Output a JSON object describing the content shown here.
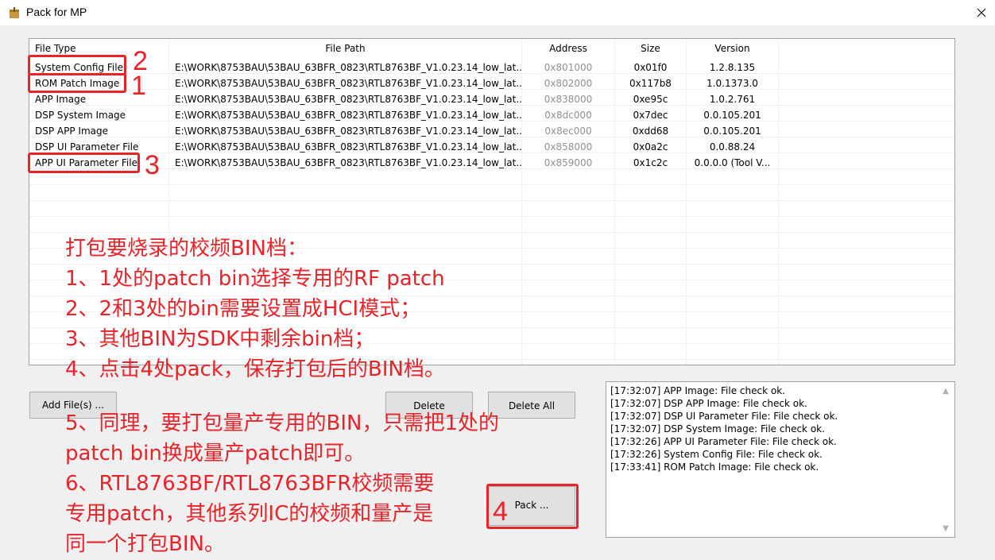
{
  "window": {
    "title": "Pack for MP"
  },
  "table": {
    "headers": [
      "File Type",
      "File Path",
      "Address",
      "Size",
      "Version"
    ],
    "rows": [
      [
        "System Config File",
        "E:\\WORK\\8753BAU\\53BAU_63BFR_0823\\RTL8763BF_V1.0.23.14_low_lat...",
        "0x801000",
        "0x01f0",
        "1.2.8.135"
      ],
      [
        "ROM Patch Image",
        "E:\\WORK\\8753BAU\\53BAU_63BFR_0823\\RTL8763BF_V1.0.23.14_low_lat...",
        "0x802000",
        "0x117b8",
        "1.0.1373.0"
      ],
      [
        "APP Image",
        "E:\\WORK\\8753BAU\\53BAU_63BFR_0823\\RTL8763BF_V1.0.23.14_low_lat...",
        "0x838000",
        "0xe95c",
        "1.0.2.761"
      ],
      [
        "DSP System Image",
        "E:\\WORK\\8753BAU\\53BAU_63BFR_0823\\RTL8763BF_V1.0.23.14_low_lat...",
        "0x8dc000",
        "0x7dec",
        "0.0.105.201"
      ],
      [
        "DSP APP Image",
        "E:\\WORK\\8753BAU\\53BAU_63BFR_0823\\RTL8763BF_V1.0.23.14_low_lat...",
        "0x8ec000",
        "0xdd68",
        "0.0.105.201"
      ],
      [
        "DSP UI Parameter File",
        "E:\\WORK\\8753BAU\\53BAU_63BFR_0823\\RTL8763BF_V1.0.23.14_low_lat...",
        "0x858000",
        "0x0a2c",
        "0.0.88.24"
      ],
      [
        "APP UI Parameter File",
        "E:\\WORK\\8753BAU\\53BAU_63BFR_0823\\RTL8763BF_V1.0.23.14_low_lat...",
        "0x859000",
        "0x1c2c",
        "0.0.0.0  (Tool V..."
      ]
    ]
  },
  "buttons": {
    "add_files": "Add File(s) ...",
    "delete": "Delete",
    "delete_all": "Delete All",
    "pack": "Pack ..."
  },
  "log": [
    "[17:32:07] APP Image: File check ok.",
    "[17:32:07] DSP APP Image: File check ok.",
    "[17:32:07] DSP UI Parameter File: File check ok.",
    "[17:32:07] DSP System Image: File check ok.",
    "[17:32:26] APP UI Parameter File: File check ok.",
    "[17:32:26] System Config File: File check ok.",
    "[17:33:41] ROM Patch Image: File check ok."
  ],
  "annotations": {
    "markers": [
      "2",
      "1",
      "3",
      "4"
    ],
    "notes": [
      "打包要烧录的校频BIN档：",
      "1、1处的patch bin选择专用的RF patch",
      "2、2和3处的bin需要设置成HCI模式；",
      "3、其他BIN为SDK中剩余bin档；",
      "4、点击4处pack，保存打包后的BIN档。",
      "5、同理，要打包量产专用的BIN，只需把1处的",
      "patch bin换成量产patch即可。",
      "6、RTL8763BF/RTL8763BFR校频需要",
      "专用patch，其他系列IC的校频和量产是",
      "同一个打包BIN。"
    ],
    "color": "#e8232a"
  }
}
